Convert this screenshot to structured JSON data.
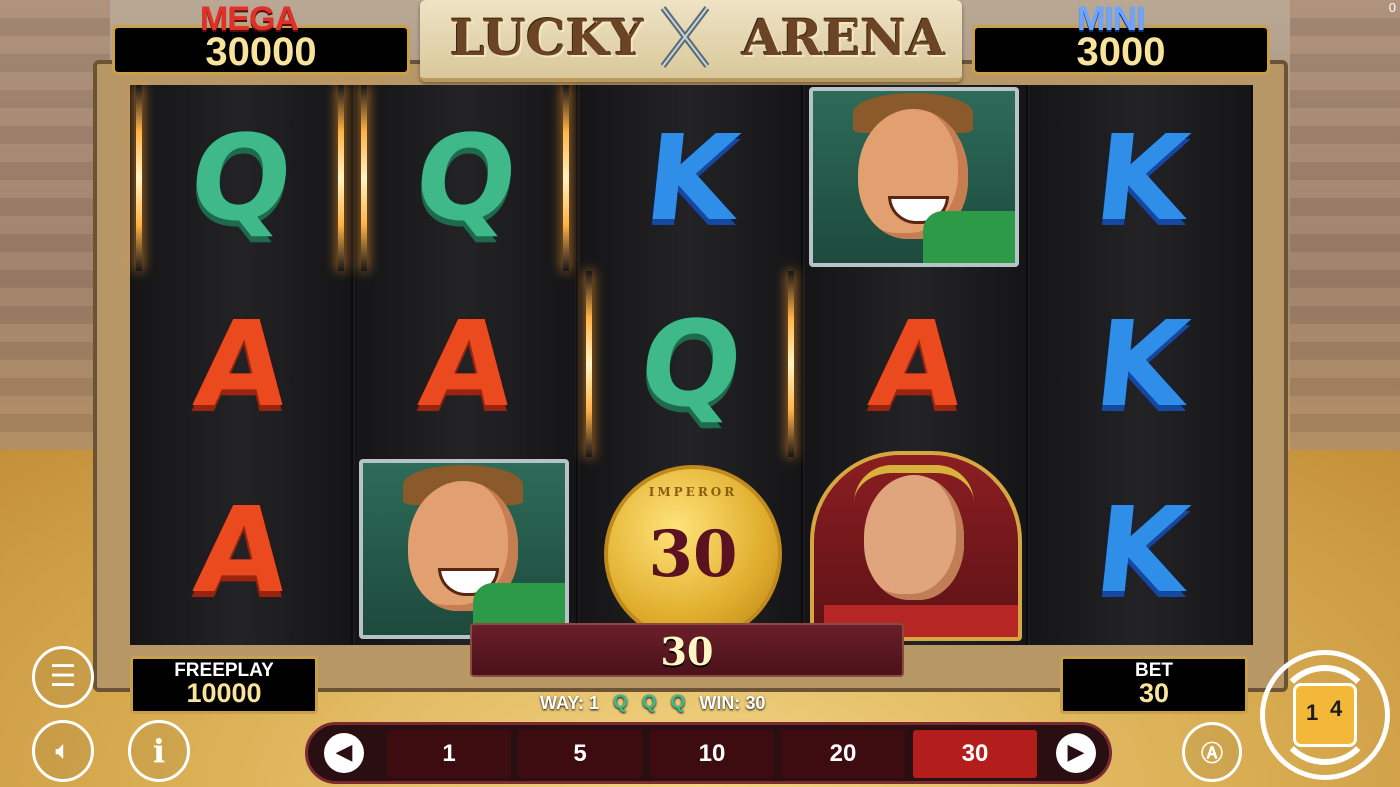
{
  "jackpots": {
    "mega": {
      "title": "MEGA",
      "value": "30000"
    },
    "mini": {
      "title": "MINI",
      "value": "3000"
    }
  },
  "logo": {
    "left": "LUCKY",
    "right": "ARENA"
  },
  "reels": [
    [
      "Q",
      "A",
      "A"
    ],
    [
      "Q",
      "A",
      "gladiator"
    ],
    [
      "K",
      "Q",
      "coin"
    ],
    [
      "gladiator",
      "A",
      "emperor"
    ],
    [
      "K",
      "K",
      "K"
    ]
  ],
  "coin": {
    "value": "30",
    "text": "IMPEROR"
  },
  "win_bar": {
    "amount": "30"
  },
  "freeplay": {
    "label": "FREEPLAY",
    "value": "10000"
  },
  "bet": {
    "label": "BET",
    "value": "30"
  },
  "win_line": {
    "way_label": "WAY: 1",
    "symbol": "Q",
    "win_label": "WIN: 30"
  },
  "bet_options": [
    "1",
    "5",
    "10",
    "20",
    "30"
  ],
  "bet_selected": "30",
  "dice": {
    "a": "1",
    "b": "4"
  },
  "corner_counter": "0",
  "colors": {
    "gold_border": "#c9a04a",
    "active_bet": "#b31e1c",
    "q": "#3fb98a",
    "k": "#2f8fe8",
    "a": "#ea4a1d"
  }
}
